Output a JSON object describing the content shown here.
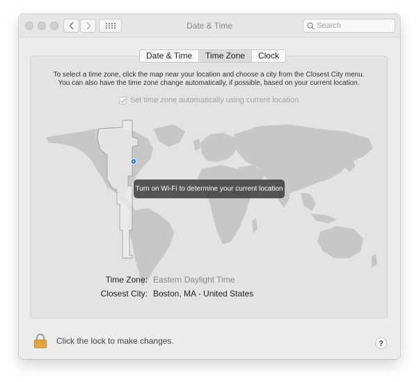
{
  "window": {
    "title": "Date & Time",
    "search_placeholder": "Search"
  },
  "tabs": [
    {
      "label": "Date & Time",
      "active": false
    },
    {
      "label": "Time Zone",
      "active": true
    },
    {
      "label": "Clock",
      "active": false
    }
  ],
  "timezone": {
    "info_line1": "To select a time zone, click the map near your location and choose a city from the Closest City menu.",
    "info_line2": "You can also have the time zone change automatically, if possible, based on your current location.",
    "auto_label": "Set time zone automatically using current location",
    "auto_checked": true,
    "toast": "Turn on Wi-Fi to determine your current location",
    "time_zone_label": "Time Zone:",
    "time_zone_value": "Eastern Daylight Time",
    "closest_city_label": "Closest City:",
    "closest_city_value": "Boston, MA - United States"
  },
  "footer": {
    "lock_text": "Click the lock to make changes.",
    "help_label": "?"
  },
  "colors": {
    "accent": "#2f7fd8",
    "lock": "#e5a53c"
  },
  "icons": {
    "lock": "lock-icon",
    "help": "question-mark-icon",
    "search": "magnifier-icon"
  }
}
